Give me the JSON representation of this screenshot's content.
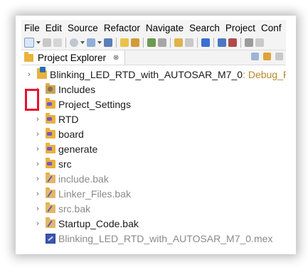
{
  "menu": [
    "File",
    "Edit",
    "Source",
    "Refactor",
    "Navigate",
    "Search",
    "Project",
    "Conf"
  ],
  "view": {
    "tab_label": "Project Explorer",
    "close_glyph": "⊗"
  },
  "tree": {
    "root": {
      "name": "Blinking_LED_RTD_with_AUTOSAR_M7_0",
      "decoration": ": Debug_RAM",
      "expanded": false
    },
    "children": [
      {
        "label": "Includes",
        "icon": "includes-icon",
        "muted": false
      },
      {
        "label": "Project_Settings",
        "icon": "source-folder-icon",
        "muted": false
      },
      {
        "label": "RTD",
        "icon": "source-folder-icon",
        "muted": false
      },
      {
        "label": "board",
        "icon": "source-folder-icon",
        "muted": false
      },
      {
        "label": "generate",
        "icon": "source-folder-icon",
        "muted": false
      },
      {
        "label": "src",
        "icon": "source-folder-icon",
        "muted": false
      },
      {
        "label": "include.bak",
        "icon": "excluded-folder-icon",
        "muted": true
      },
      {
        "label": "Linker_Files.bak",
        "icon": "excluded-folder-icon",
        "muted": true
      },
      {
        "label": "src.bak",
        "icon": "excluded-folder-icon",
        "muted": true
      },
      {
        "label": "Startup_Code.bak",
        "icon": "excluded-folder-icon",
        "muted": false
      },
      {
        "label": "Blinking_LED_RTD_with_AUTOSAR_M7_0.mex",
        "icon": "mex-file-icon",
        "muted": true
      }
    ]
  },
  "colors": {
    "highlight": "#e8112d",
    "decoration": "#b58a2a",
    "muted_text": "#8a8a8a"
  }
}
